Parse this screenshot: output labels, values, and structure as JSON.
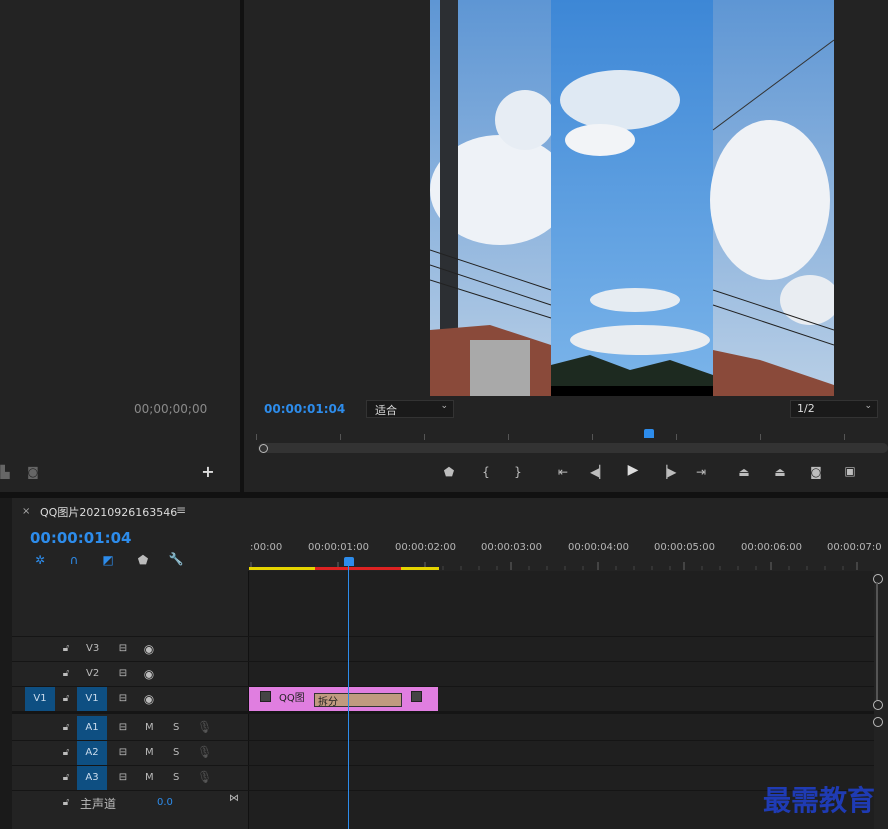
{
  "source_monitor": {
    "timecode": "00;00;00;00"
  },
  "program_monitor": {
    "timecode": "00:00:01:04",
    "fit_select": "适合",
    "resolution_select": "1/2"
  },
  "sequence": {
    "name": "QQ图片20210926163546",
    "timecode": "00:00:01:04",
    "ruler_labels": [
      ":00:00",
      "00:00:01:00",
      "00:00:02:00",
      "00:00:03:00",
      "00:00:04:00",
      "00:00:05:00",
      "00:00:06:00",
      "00:00:07:0"
    ]
  },
  "tracks": {
    "v3": "V3",
    "v2": "V2",
    "v1": "V1",
    "v1_src": "V1",
    "a1": "A1",
    "a2": "A2",
    "a3": "A3",
    "m": "M",
    "s": "S",
    "master_label": "主声道",
    "master_value": "0.0"
  },
  "clip": {
    "label": "QQ图",
    "fx": "fx",
    "tooltip": "拆分"
  },
  "watermark": "最需教育",
  "colors": {
    "accent": "#2d8ceb",
    "clip": "#e07ee0",
    "playhead": "#2d8ceb"
  }
}
